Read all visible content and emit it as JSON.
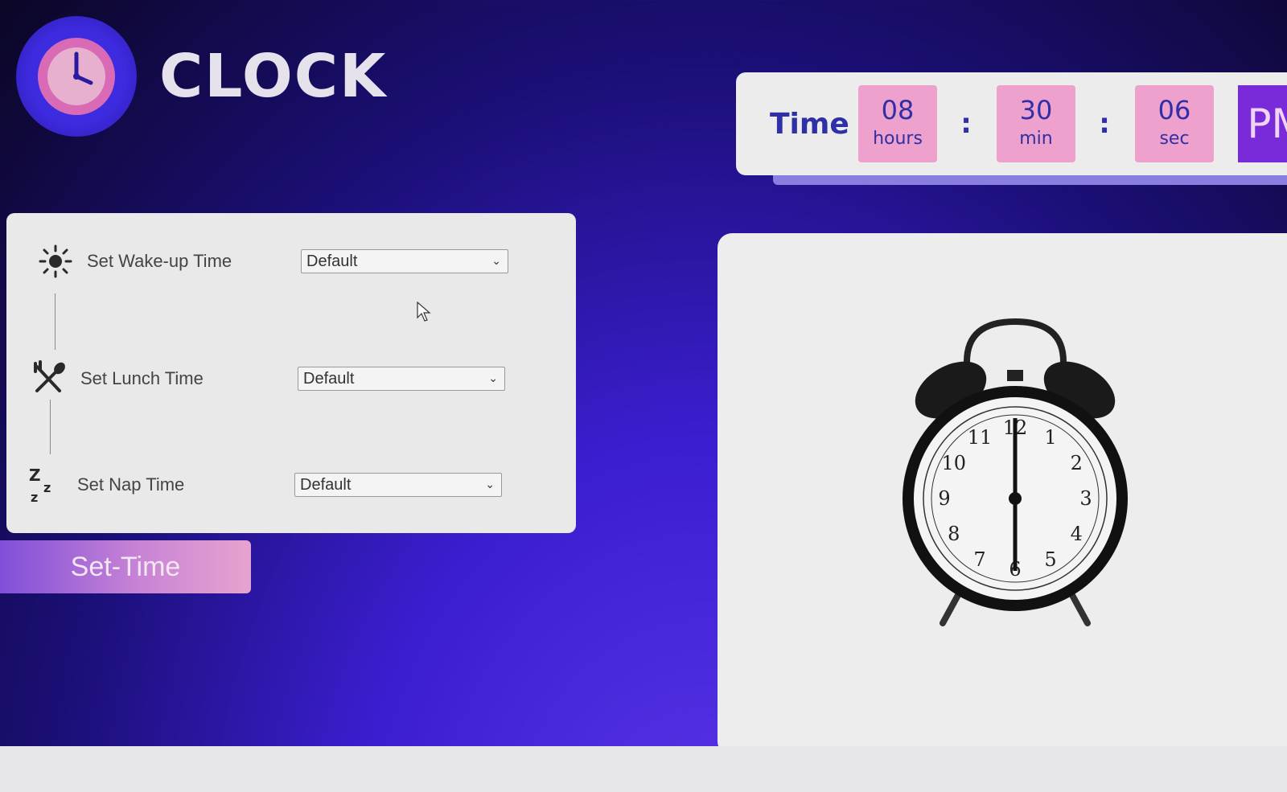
{
  "app": {
    "title": "CLOCK"
  },
  "time_display": {
    "label": "Time",
    "hours": {
      "value": "08",
      "unit": "hours"
    },
    "minutes": {
      "value": "30",
      "unit": "min"
    },
    "seconds": {
      "value": "06",
      "unit": "sec"
    },
    "separator": ":",
    "period": "PM"
  },
  "form": {
    "rows": [
      {
        "label": "Set Wake-up Time",
        "selected": "Default",
        "icon": "sun-icon"
      },
      {
        "label": "Set Lunch Time",
        "selected": "Default",
        "icon": "fork-spoon-icon"
      },
      {
        "label": "Set Nap Time",
        "selected": "Default",
        "icon": "sleep-zzz-icon"
      }
    ]
  },
  "actions": {
    "set_time_label": "Set-Time"
  },
  "illustration": {
    "clock_numbers": [
      "12",
      "1",
      "2",
      "3",
      "4",
      "5",
      "6",
      "7",
      "8",
      "9",
      "10",
      "11"
    ]
  },
  "colors": {
    "accent_pink": "#eea1cd",
    "accent_purple": "#7a2bd9",
    "text_blue": "#2f2fa6"
  }
}
